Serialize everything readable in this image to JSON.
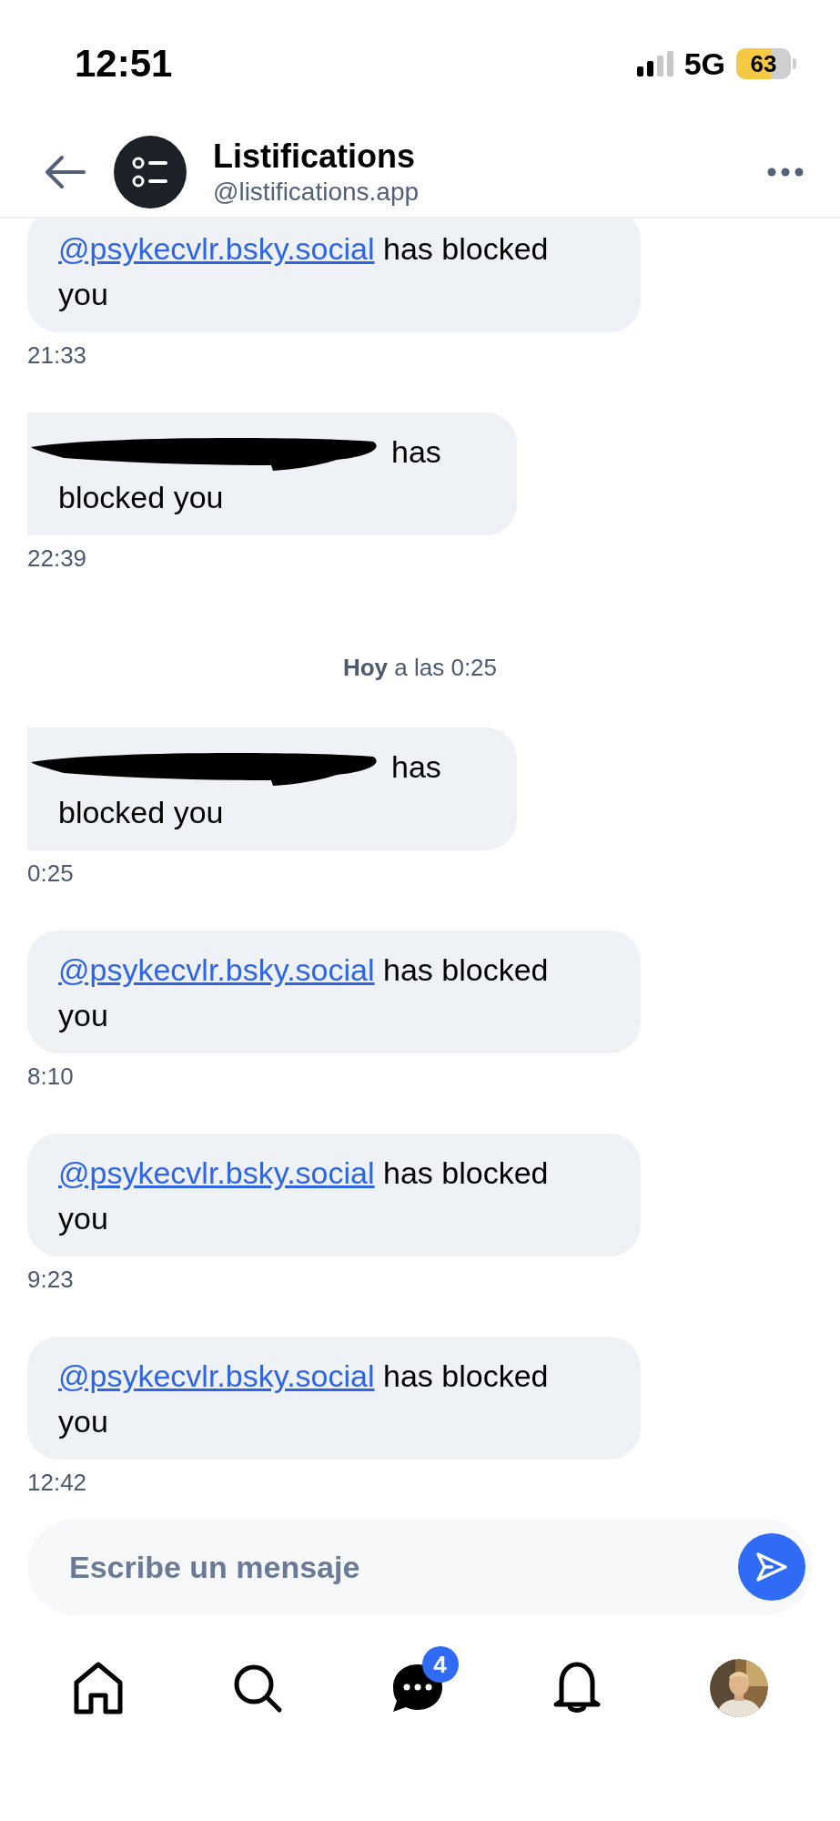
{
  "status_bar": {
    "time": "12:51",
    "network": "5G",
    "battery": "63"
  },
  "header": {
    "title": "Listifications",
    "handle": "@listifications.app"
  },
  "messages": [
    {
      "kind": "mention",
      "handle": "@psykecvlr.bsky.social",
      "text": "has blocked you",
      "time": "21:33"
    },
    {
      "kind": "redacted",
      "line_1": "has",
      "line_2": "blocked you",
      "time": "22:39"
    },
    {
      "kind": "divider",
      "text": "**Hoy** a las 0:25"
    },
    {
      "kind": "redacted",
      "line_1": "has",
      "line_2": "blocked you",
      "time": "0:25"
    },
    {
      "kind": "mention",
      "handle": "@psykecvlr.bsky.social",
      "text": "has blocked you",
      "time": "8:10"
    },
    {
      "kind": "mention",
      "handle": "@psykecvlr.bsky.social",
      "text": "has blocked you",
      "time": "9:23"
    },
    {
      "kind": "mention",
      "handle": "@psykecvlr.bsky.social",
      "text": "has blocked you",
      "time": "12:42"
    }
  ],
  "composer": {
    "placeholder": "Escribe un mensaje"
  },
  "tab_bar": {
    "messages_badge": "4"
  }
}
